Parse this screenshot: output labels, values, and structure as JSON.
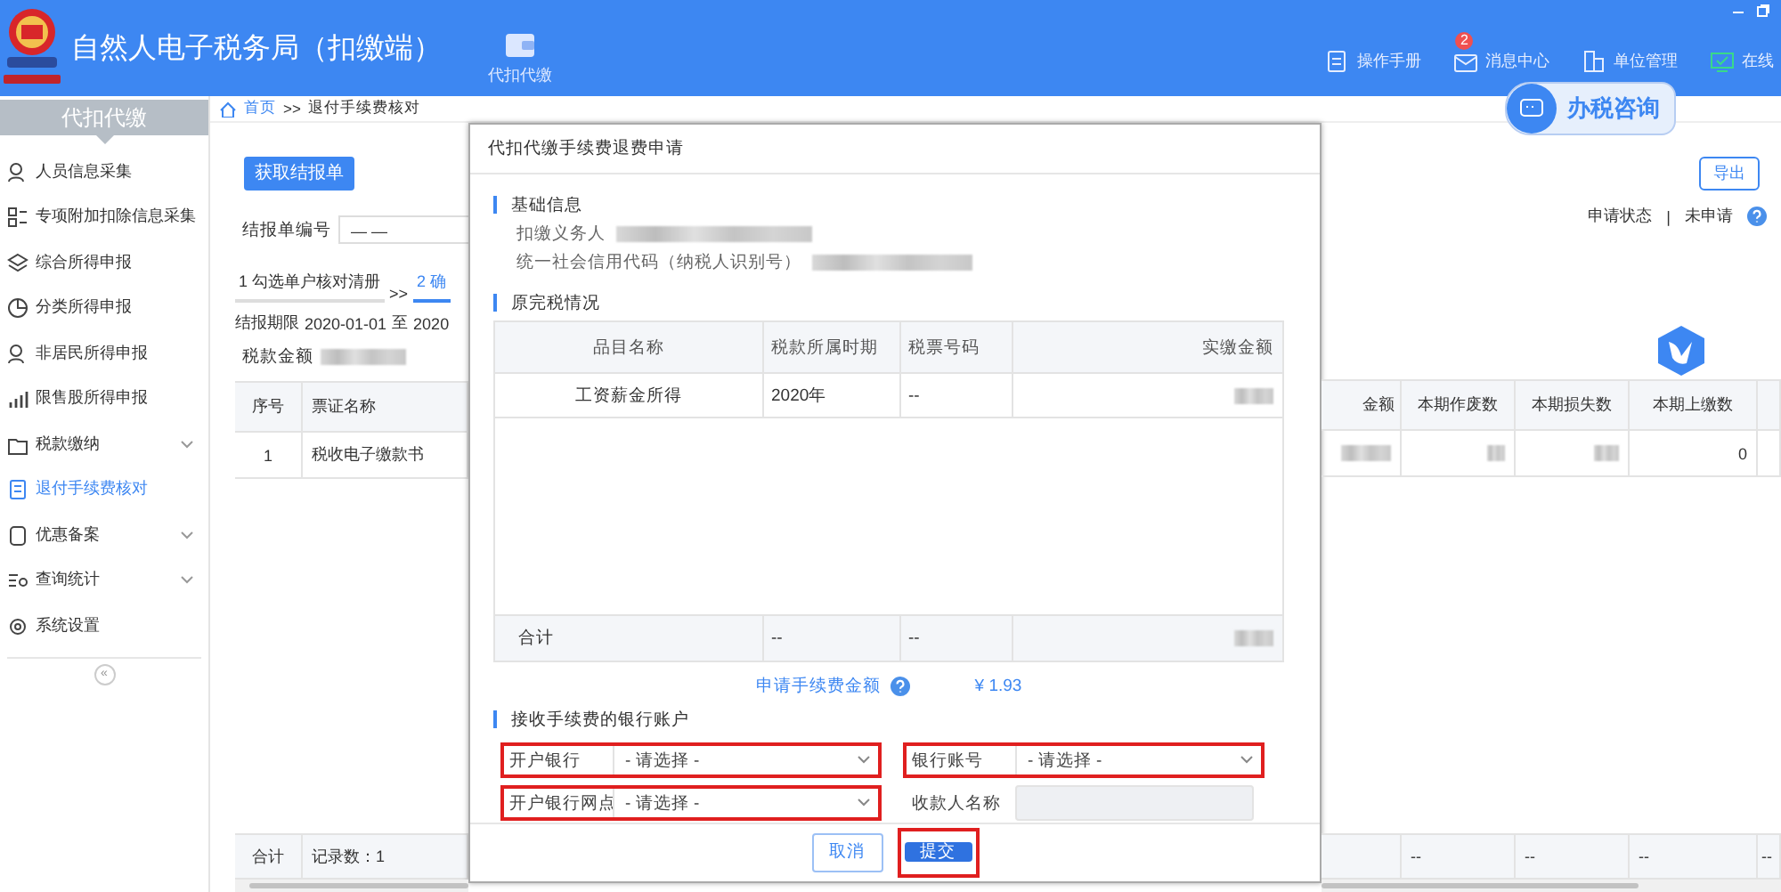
{
  "header": {
    "title": "自然人电子税务局（扣缴端）",
    "module": {
      "label": "代扣代缴",
      "selected": true
    },
    "links": [
      {
        "label": "操作手册"
      },
      {
        "label": "消息中心",
        "badge": "2"
      },
      {
        "label": "单位管理"
      },
      {
        "label": "在线"
      }
    ]
  },
  "consult_button": "办税咨询",
  "sidebar": {
    "title": "代扣代缴",
    "items": [
      {
        "label": "人员信息采集",
        "selected": false,
        "expandable": false
      },
      {
        "label": "专项附加扣除信息采集",
        "selected": false,
        "expandable": false
      },
      {
        "label": "综合所得申报",
        "selected": false,
        "expandable": false
      },
      {
        "label": "分类所得申报",
        "selected": false,
        "expandable": false
      },
      {
        "label": "非居民所得申报",
        "selected": false,
        "expandable": false
      },
      {
        "label": "限售股所得申报",
        "selected": false,
        "expandable": false
      },
      {
        "label": "税款缴纳",
        "selected": false,
        "expandable": true
      },
      {
        "label": "退付手续费核对",
        "selected": true,
        "expandable": false
      },
      {
        "label": "优惠备案",
        "selected": false,
        "expandable": true
      },
      {
        "label": "查询统计",
        "selected": false,
        "expandable": true
      },
      {
        "label": "系统设置",
        "selected": false,
        "expandable": false
      }
    ],
    "collapse": "«"
  },
  "breadcrumb": {
    "home": "首页",
    "separator": ">>",
    "current": "退付手续费核对"
  },
  "toolbar": {
    "fetch_button": "获取结报单",
    "export_button": "导出"
  },
  "filter": {
    "label": "结报单编号",
    "value": "— —"
  },
  "status": {
    "label": "申请状态",
    "separator": "|",
    "value": "未申请"
  },
  "steps": [
    {
      "label": "1 勾选单户核对清册",
      "selected": false
    },
    {
      "label": "2 确",
      "selected": true
    }
  ],
  "step_separator": ">>",
  "period": {
    "label": "结报期限",
    "start": "2020-01-01",
    "to": "至",
    "end": "2020"
  },
  "tax_amount": {
    "label": "税款金额"
  },
  "table": {
    "left_columns": [
      "序号",
      "票证名称"
    ],
    "right_columns": [
      "金额",
      "本期作废数",
      "本期损失数",
      "本期上缴数"
    ],
    "rows": [
      {
        "index": "1",
        "name": "税收电子缴款书",
        "column_6": "0"
      }
    ],
    "footer": {
      "label": "合计",
      "count": "记录数：1",
      "cells": [
        "--",
        "--",
        "--",
        "--"
      ]
    }
  },
  "dialog": {
    "title": "代扣代缴手续费退费申请",
    "basic": {
      "heading": "基础信息",
      "fields": [
        {
          "label": "扣缴义务人"
        },
        {
          "label": "统一社会信用代码（纳税人识别号）"
        }
      ]
    },
    "paid": {
      "heading": "原完税情况",
      "columns": [
        "品目名称",
        "税款所属时期",
        "税票号码",
        "实缴金额"
      ],
      "rows": [
        {
          "item": "工资薪金所得",
          "period": "2020年",
          "ticket": "--"
        }
      ],
      "total": {
        "label": "合计",
        "period": "--",
        "ticket": "--"
      }
    },
    "fee": {
      "label": "申请手续费金额",
      "amount": "¥ 1.93"
    },
    "bank": {
      "heading": "接收手续费的银行账户",
      "fields": [
        {
          "kind": "select",
          "label": "开户银行",
          "placeholder": "- 请选择 -",
          "highlighted": true
        },
        {
          "kind": "select",
          "label": "银行账号",
          "placeholder": "- 请选择 -",
          "highlighted": true
        },
        {
          "kind": "select",
          "label": "开户银行网点",
          "placeholder": "- 请选择 -",
          "highlighted": true
        },
        {
          "kind": "input",
          "label": "收款人名称",
          "disabled": true,
          "highlighted": false
        }
      ]
    },
    "buttons": [
      {
        "label": "取消",
        "kind": "secondary",
        "highlighted": false
      },
      {
        "label": "提交",
        "kind": "primary",
        "highlighted": true
      }
    ]
  }
}
